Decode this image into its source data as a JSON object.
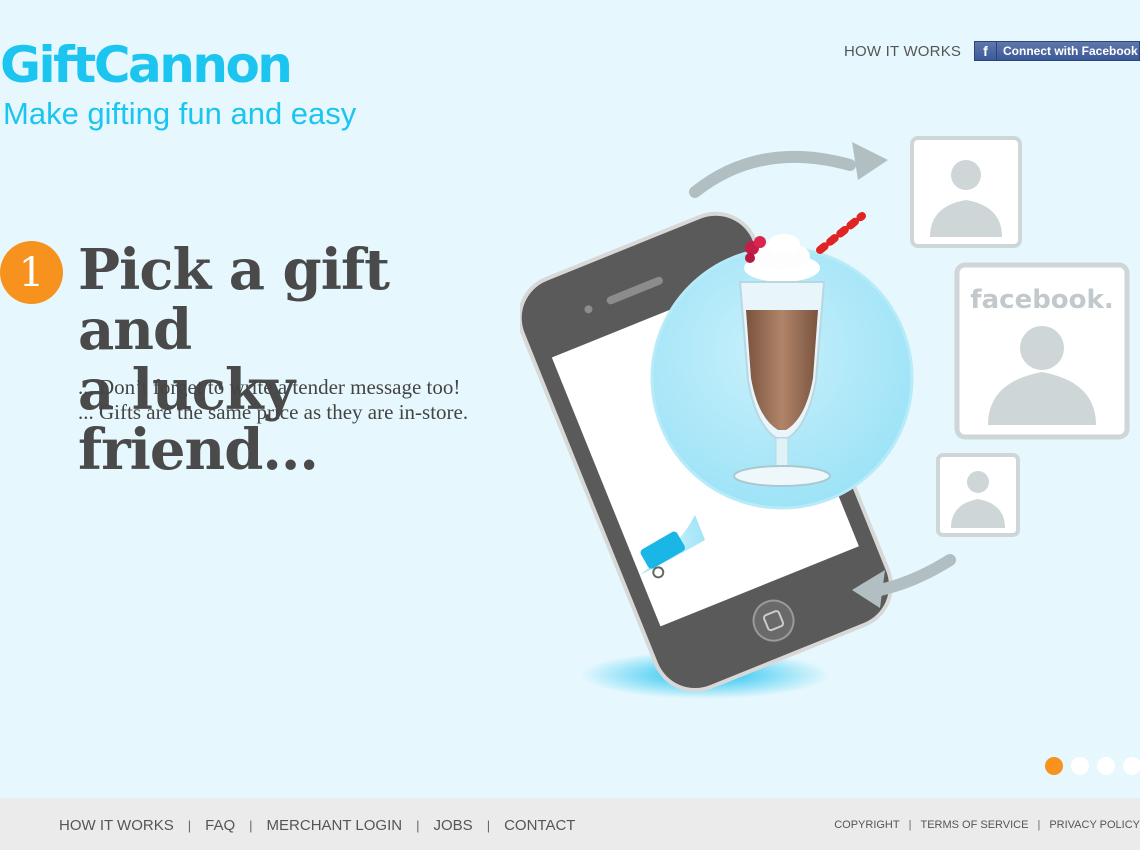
{
  "brand": {
    "logo": "GiftCannon",
    "tagline": "Make gifting fun and easy"
  },
  "header": {
    "how_it_works": "HOW IT WORKS",
    "facebook_button": "Connect with Facebook",
    "facebook_glyph": "f"
  },
  "hero": {
    "step_number": "1",
    "headline_line1": "Pick a gift and",
    "headline_line2": "a lucky friend...",
    "sub1": "... Don’t forget to write a tender message too!",
    "sub2": "... Gifts are the same price as they are in-store."
  },
  "illustration": {
    "facebook_word": "facebook."
  },
  "carousel": {
    "total": 4,
    "active": 1
  },
  "footer": {
    "nav": [
      "HOW IT WORKS",
      "FAQ",
      "MERCHANT LOGIN",
      "JOBS",
      "CONTACT"
    ],
    "legal": [
      "COPYRIGHT",
      "TERMS OF SERVICE",
      "PRIVACY POLICY"
    ],
    "separator": "|"
  },
  "colors": {
    "background": "#e6f8fd",
    "brand_cyan": "#1cc5ef",
    "accent_orange": "#f7921e",
    "facebook_blue": "#3b5998",
    "footer_gray": "#ebebeb"
  }
}
